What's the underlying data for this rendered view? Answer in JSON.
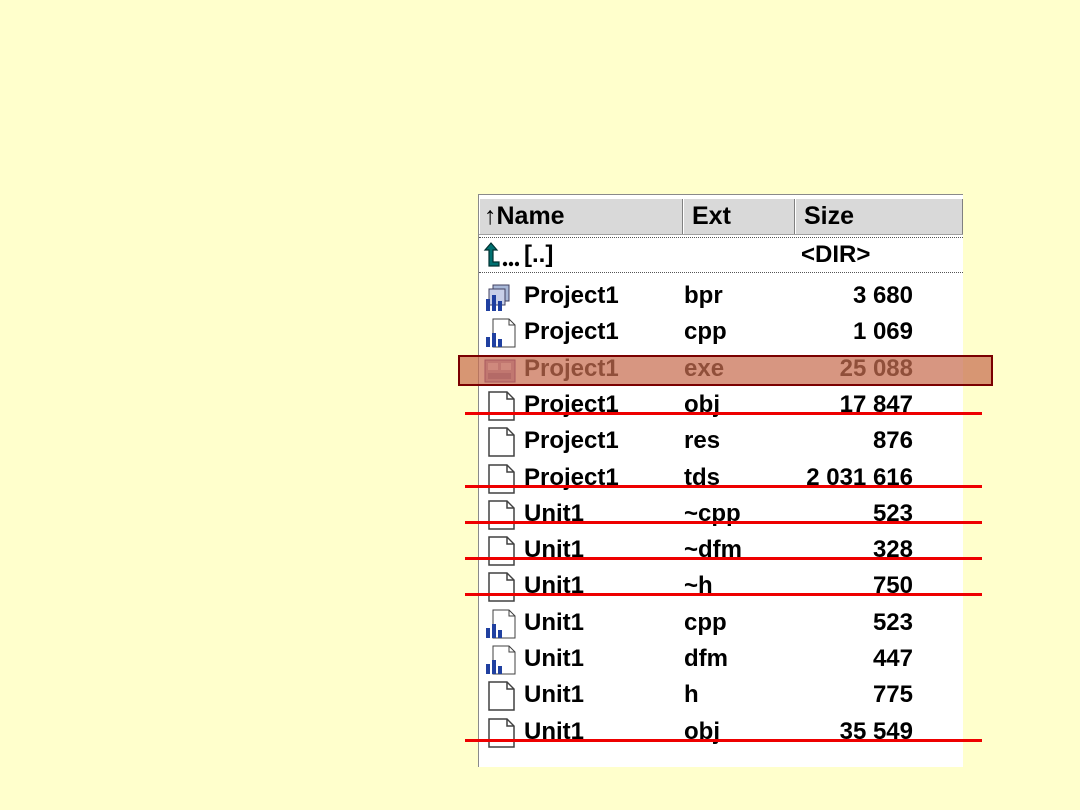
{
  "header": {
    "sort_indicator": "↑",
    "name_label": "Name",
    "ext_label": "Ext",
    "size_label": "Size"
  },
  "parent_row": {
    "icon": "up-folder-icon",
    "name": "[..]",
    "size": "<DIR>"
  },
  "files": [
    {
      "name": "Project1",
      "ext": "bpr",
      "size": "3 680",
      "icon": "project-group-icon",
      "crossed": false,
      "highlighted": false
    },
    {
      "name": "Project1",
      "ext": "cpp",
      "size": "1 069",
      "icon": "source-file-icon",
      "crossed": false,
      "highlighted": false
    },
    {
      "name": "Project1",
      "ext": "exe",
      "size": "25 088",
      "icon": "executable-icon",
      "crossed": false,
      "highlighted": true
    },
    {
      "name": "Project1",
      "ext": "obj",
      "size": "17 847",
      "icon": "file-icon",
      "crossed": true,
      "highlighted": false
    },
    {
      "name": "Project1",
      "ext": "res",
      "size": "876",
      "icon": "file-icon",
      "crossed": false,
      "highlighted": false
    },
    {
      "name": "Project1",
      "ext": "tds",
      "size": "2 031 616",
      "icon": "file-icon",
      "crossed": true,
      "highlighted": false
    },
    {
      "name": "Unit1",
      "ext": "~cpp",
      "size": "523",
      "icon": "file-icon",
      "crossed": true,
      "highlighted": false
    },
    {
      "name": "Unit1",
      "ext": "~dfm",
      "size": "328",
      "icon": "file-icon",
      "crossed": true,
      "highlighted": false
    },
    {
      "name": "Unit1",
      "ext": "~h",
      "size": "750",
      "icon": "file-icon",
      "crossed": true,
      "highlighted": false
    },
    {
      "name": "Unit1",
      "ext": "cpp",
      "size": "523",
      "icon": "source-file-icon",
      "crossed": false,
      "highlighted": false
    },
    {
      "name": "Unit1",
      "ext": "dfm",
      "size": "447",
      "icon": "source-file-icon",
      "crossed": false,
      "highlighted": false
    },
    {
      "name": "Unit1",
      "ext": "h",
      "size": "775",
      "icon": "file-icon",
      "crossed": false,
      "highlighted": false
    },
    {
      "name": "Unit1",
      "ext": "obj",
      "size": "35 549",
      "icon": "file-icon",
      "crossed": true,
      "highlighted": false
    }
  ],
  "colors": {
    "background": "#ffffcc",
    "strike": "#ee0000",
    "highlight_fill": "#c76e50",
    "highlight_border": "#7a0000"
  }
}
